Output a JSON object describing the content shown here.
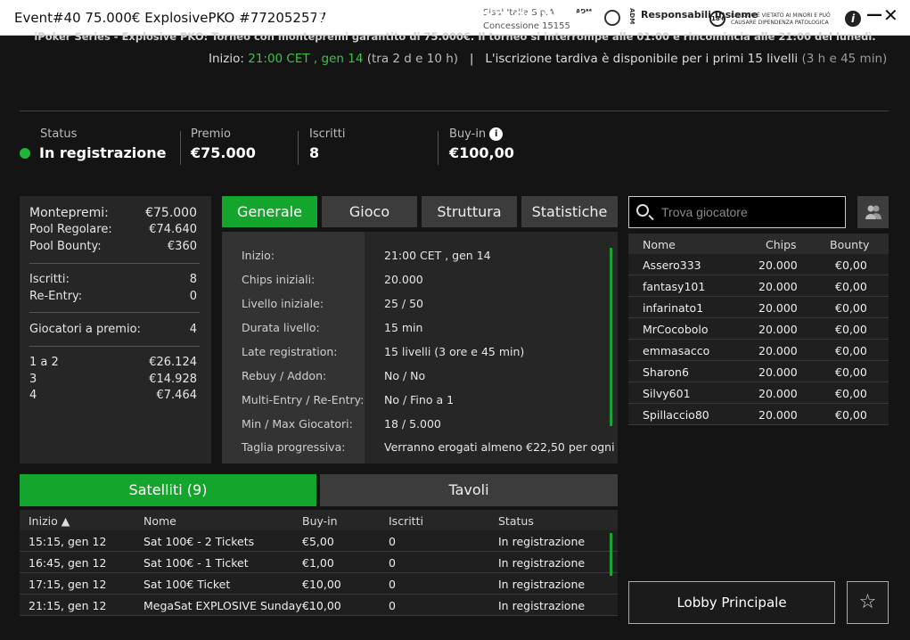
{
  "window": {
    "title": "Event#40 75.000€ ExplosivePKO #772052577",
    "operator": "Sisal Italia S.p.A.",
    "concession": "Concessione 15155",
    "adm": "ADM",
    "responsible": "Responsabili Insieme",
    "age_badge": "18+",
    "warning": "IL GIOCO È VIETATO AI MINORI E PUÒ CAUSARE DIPENDENZA PATOLOGICA",
    "info_glyph": "i",
    "minimize_glyph": "—",
    "close_glyph": "✕"
  },
  "header": {
    "title": "EVENT#40 75.000€ EXPLOSIVEPKO",
    "subtitle": "iPoker Series - Explosive PKO: Torneo con montepremi garantito di 75.000€. Il torneo si interrompe alle 01:00 e rincomincia alle 21:00 del lunedì.",
    "start_label": "Inizio:",
    "start_time": "21:00 CET , gen 14",
    "start_rel": "(tra 2 d e 10 h)",
    "sep": "|",
    "late_text": "L'iscrizione tardiva è disponibile per i primi 15 livelli",
    "late_rel": "(3 h e 45 min)"
  },
  "stats": {
    "status_label": "Status",
    "status_value": "In registrazione",
    "prize_label": "Premio",
    "prize_value": "€75.000",
    "entrants_label": "Iscritti",
    "entrants_value": "8",
    "buyin_label": "Buy-in",
    "buyin_value": "€100,00",
    "status_color": "#1fb53a"
  },
  "prize_box": {
    "rows1": [
      {
        "k": "Montepremi:",
        "v": "€75.000"
      },
      {
        "k": "Pool Regolare:",
        "v": "€74.640"
      },
      {
        "k": "Pool Bounty:",
        "v": "€360"
      }
    ],
    "rows2": [
      {
        "k": "Iscritti:",
        "v": "8"
      },
      {
        "k": "Re-Entry:",
        "v": "0"
      }
    ],
    "rows3": [
      {
        "k": "Giocatori a premio:",
        "v": "4"
      }
    ],
    "payouts": [
      {
        "k": "1  a  2",
        "v": "€26.124"
      },
      {
        "k": "3",
        "v": "€14.928"
      },
      {
        "k": "4",
        "v": "€7.464"
      }
    ]
  },
  "tabs": [
    "Generale",
    "Gioco",
    "Struttura",
    "Statistiche"
  ],
  "general": [
    {
      "k": "Inizio:",
      "v": "21:00 CET , gen 14"
    },
    {
      "k": "Chips iniziali:",
      "v": "20.000"
    },
    {
      "k": "Livello iniziale:",
      "v": "25 / 50"
    },
    {
      "k": "Durata livello:",
      "v": "15 min"
    },
    {
      "k": "Late registration:",
      "v": "15 livelli (3 ore e 45 min)"
    },
    {
      "k": "Rebuy / Addon:",
      "v": "No / No"
    },
    {
      "k": "Multi-Entry / Re-Entry:",
      "v": "No / Fino a 1"
    },
    {
      "k": "Min / Max Giocatori:",
      "v": "18 / 5.000"
    },
    {
      "k": "Taglia progressiva:",
      "v": "Verranno erogati almeno €22,50 per ogni"
    }
  ],
  "search": {
    "placeholder": "Trova giocatore"
  },
  "players": {
    "headers": [
      "Nome",
      "Chips",
      "Bounty"
    ],
    "rows": [
      [
        "Assero333",
        "20.000",
        "€0,00"
      ],
      [
        "fantasy101",
        "20.000",
        "€0,00"
      ],
      [
        "infarinato1",
        "20.000",
        "€0,00"
      ],
      [
        "MrCocobolo",
        "20.000",
        "€0,00"
      ],
      [
        "emmasacco",
        "20.000",
        "€0,00"
      ],
      [
        "Sharon6",
        "20.000",
        "€0,00"
      ],
      [
        "Silvy601",
        "20.000",
        "€0,00"
      ],
      [
        "Spillaccio80",
        "20.000",
        "€0,00"
      ]
    ]
  },
  "bottom_tabs": [
    "Satelliti (9)",
    "Tavoli"
  ],
  "satellites": {
    "headers": [
      "Inizio ▲",
      "Nome",
      "Buy-in",
      "Iscritti",
      "Status"
    ],
    "rows": [
      [
        "15:15, gen 12",
        "Sat 100€ - 2 Tickets",
        "€5,00",
        "0",
        "In registrazione"
      ],
      [
        "16:45, gen 12",
        "Sat 100€ - 1 Ticket",
        "€1,00",
        "0",
        "In registrazione"
      ],
      [
        "17:15, gen 12",
        "Sat 100€ Ticket",
        "€10,00",
        "0",
        "In registrazione"
      ],
      [
        "21:15, gen 12",
        "MegaSat EXPLOSIVE Sunday ...",
        "€10,00",
        "0",
        "In registrazione"
      ]
    ]
  },
  "lobby_label": "Lobby Principale",
  "star_glyph": "☆"
}
